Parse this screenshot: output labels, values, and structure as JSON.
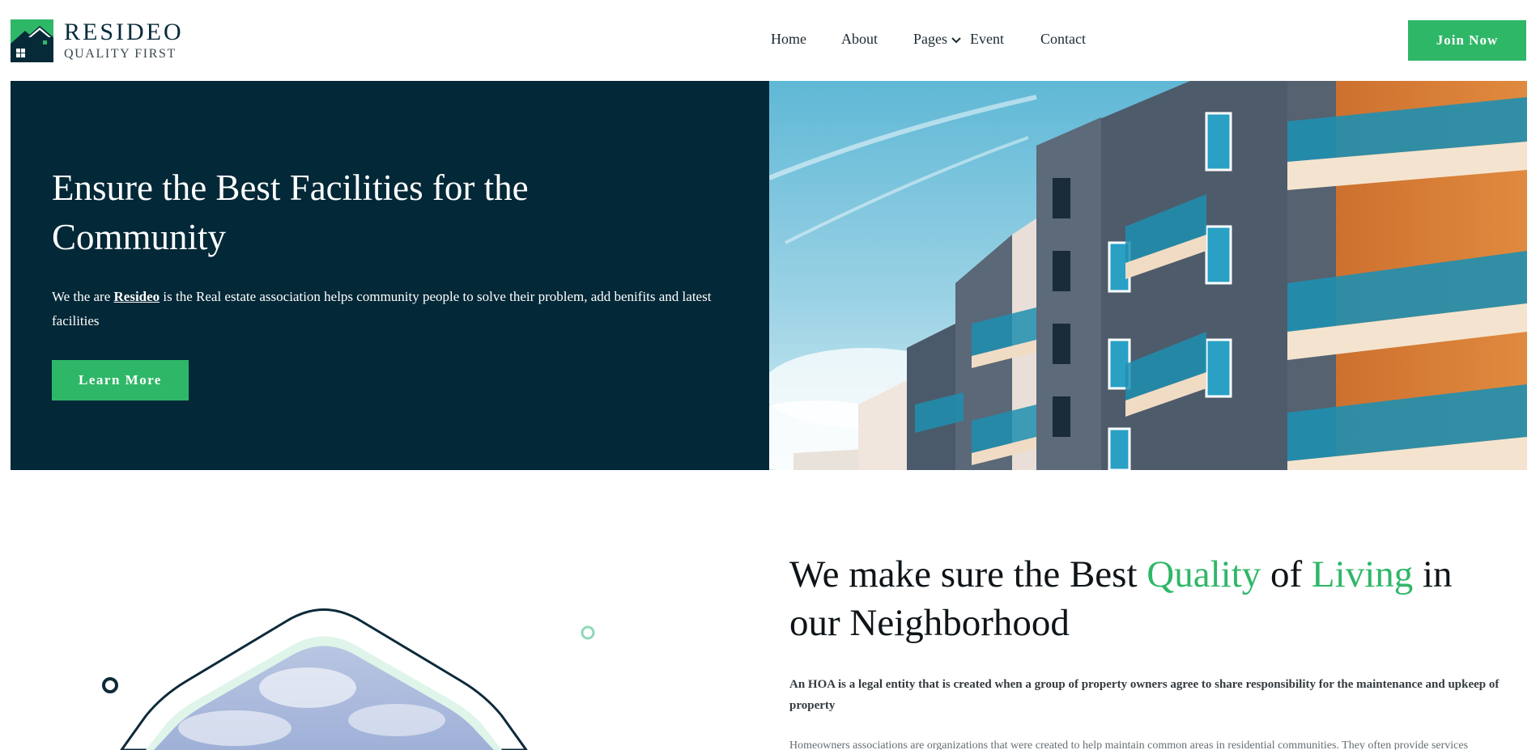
{
  "brand": {
    "name": "RESIDEO",
    "tagline": "QUALITY FIRST"
  },
  "nav": {
    "items": [
      {
        "label": "Home"
      },
      {
        "label": "About"
      },
      {
        "label": "Pages"
      },
      {
        "label": "Event"
      },
      {
        "label": "Contact"
      }
    ],
    "cta_label": "Join Now"
  },
  "hero": {
    "title": "Ensure the Best Facilities for the Community",
    "desc_prefix": "We the are ",
    "desc_brand": "Resideo",
    "desc_suffix": " is the Real estate association helps community people to solve their problem, add benifits and latest facilities",
    "button_label": "Learn More"
  },
  "about": {
    "title_part1": "We make sure the Best ",
    "title_accent1": "Quality",
    "title_part2": " of ",
    "title_accent2": "Living",
    "title_part3": " in our Neighborhood",
    "lead": "An HOA is a legal entity that is created when a group of property owners agree to share responsibility for the maintenance and upkeep of property",
    "body": "Homeowners associations are organizations that were created to help maintain common areas in residential communities. They often provide services"
  },
  "colors": {
    "accent_green": "#2fb768",
    "dark_navy": "#032837",
    "white": "#ffffff"
  }
}
